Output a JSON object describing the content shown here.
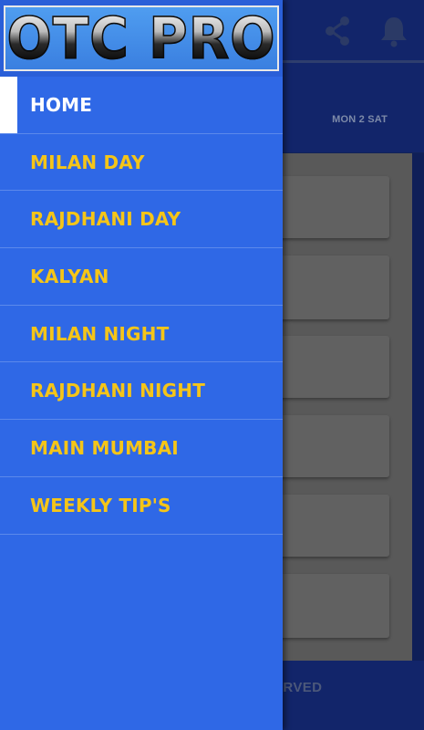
{
  "app_bar": {
    "icons": [
      "share-icon",
      "bell-icon"
    ]
  },
  "day_label": "MON 2 SAT",
  "footer": {
    "text": "ERVED"
  },
  "drawer": {
    "logo_text": "OTC PRO",
    "menu": [
      {
        "label": "HOME",
        "active": true
      },
      {
        "label": "MILAN DAY"
      },
      {
        "label": "RAJDHANI DAY"
      },
      {
        "label": "KALYAN"
      },
      {
        "label": "MILAN NIGHT"
      },
      {
        "label": "RAJDHANI NIGHT"
      },
      {
        "label": "MAIN MUMBAI"
      },
      {
        "label": "WEEKLY TIP'S"
      }
    ]
  },
  "colors": {
    "drawer_bg": "#2f68e6",
    "menu_text": "#f5c518",
    "active_text": "#ffffff",
    "app_bar_bg": "#12256a"
  }
}
